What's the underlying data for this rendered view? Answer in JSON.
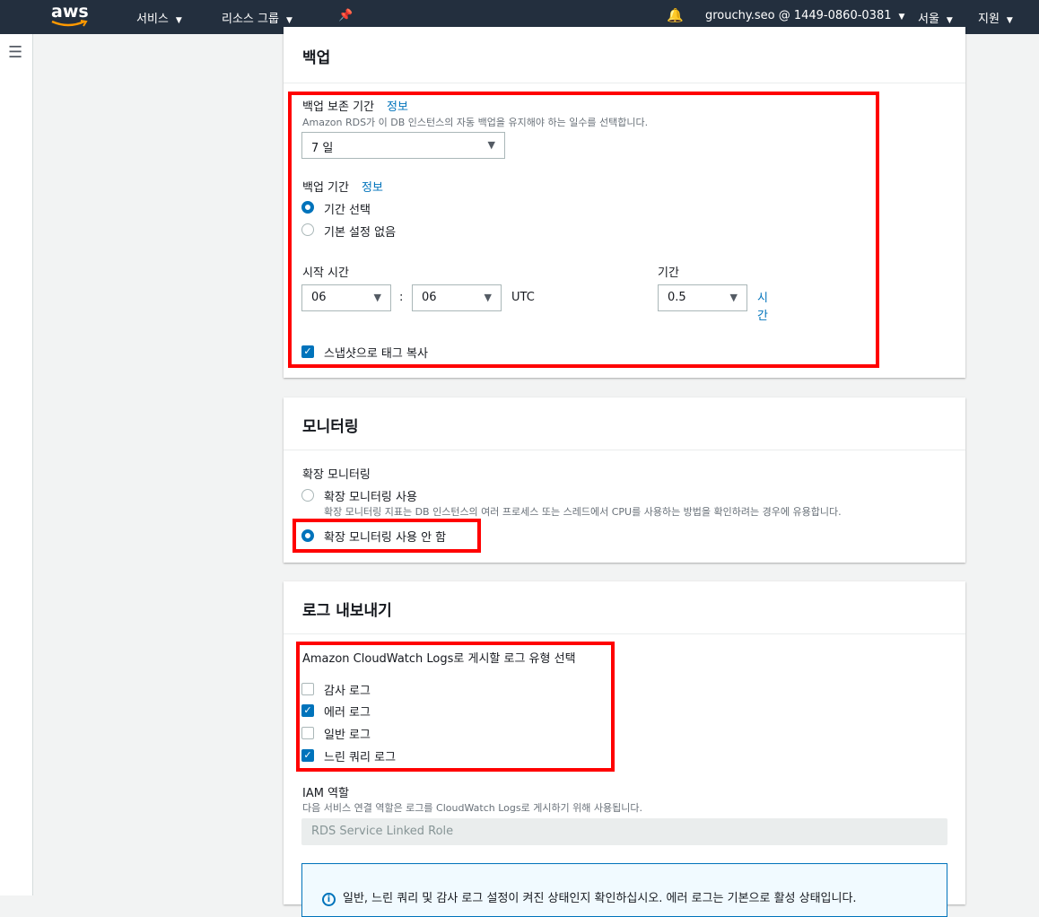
{
  "nav": {
    "logo": "aws",
    "services": "서비스",
    "resource_groups": "리소스 그룹",
    "account": "grouchy.seo @ 1449-0860-0381",
    "region": "서울",
    "support": "지원"
  },
  "backup": {
    "title": "백업",
    "retention_label": "백업 보존 기간",
    "info": "정보",
    "retention_desc": "Amazon RDS가 이 DB 인스턴스의 자동 백업을 유지해야 하는 일수를 선택합니다.",
    "retention_value": "7 일",
    "window_label": "백업 기간",
    "opt_select": "기간 선택",
    "opt_none": "기본 설정 없음",
    "start_label": "시작 시간",
    "hour": "06",
    "colon": ":",
    "minute": "06",
    "utc": "UTC",
    "duration_label": "기간",
    "duration_value": "0.5",
    "duration_unit": "시간",
    "copy_tags": "스냅샷으로 태그 복사"
  },
  "monitoring": {
    "title": "모니터링",
    "label": "확장 모니터링",
    "enable": "확장 모니터링 사용",
    "enable_desc": "확장 모니터링 지표는 DB 인스턴스의 여러 프로세스 또는 스레드에서 CPU를 사용하는 방법을 확인하려는 경우에 유용합니다.",
    "disable": "확장 모니터링 사용 안 함"
  },
  "logs": {
    "title": "로그 내보내기",
    "label": "Amazon CloudWatch Logs로 게시할 로그 유형 선택",
    "items": [
      {
        "label": "감사 로그",
        "checked": false
      },
      {
        "label": "에러 로그",
        "checked": true
      },
      {
        "label": "일반 로그",
        "checked": false
      },
      {
        "label": "느린 쿼리 로그",
        "checked": true
      }
    ],
    "iam_label": "IAM 역할",
    "iam_desc": "다음 서비스 연결 역할은 로그를 CloudWatch Logs로 게시하기 위해 사용됩니다.",
    "iam_value": "RDS Service Linked Role",
    "info_text": "일반, 느린 쿼리 및 감사 로그 설정이 켜진 상태인지 확인하십시오. 에러 로그는 기본으로 활성 상태입니다."
  }
}
